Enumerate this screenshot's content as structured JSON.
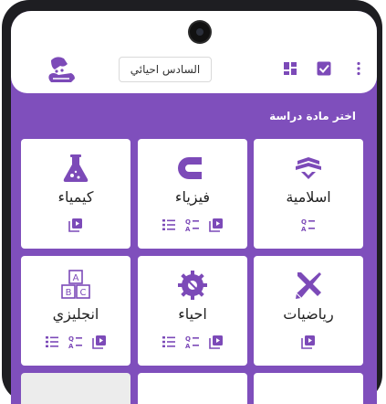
{
  "header": {
    "grade_select": "السادس احيائي"
  },
  "section_title": "اختر مادة دراسة",
  "subjects": [
    {
      "name": "اسلامية",
      "icon": "quran-icon",
      "actions": [
        "list-icon",
        "qa-icon"
      ]
    },
    {
      "name": "فيزياء",
      "icon": "magnet-icon",
      "actions": [
        "list-icon",
        "qa-icon",
        "video-icon"
      ]
    },
    {
      "name": "كيمياء",
      "icon": "flask-icon",
      "actions": [
        "video-icon"
      ]
    },
    {
      "name": "رياضيات",
      "icon": "ruler-pencil-icon",
      "actions": [
        "video-icon"
      ]
    },
    {
      "name": "احياء",
      "icon": "gear-icon",
      "actions": [
        "list-icon",
        "qa-icon",
        "video-icon"
      ]
    },
    {
      "name": "انجليزي",
      "icon": "abc-blocks-icon",
      "actions": [
        "list-icon",
        "qa-icon",
        "video-icon"
      ]
    }
  ],
  "colors": {
    "primary": "#7f4fbc",
    "accent_yellow": "#f3c21a",
    "icon_purple": "#7c4ab8"
  }
}
